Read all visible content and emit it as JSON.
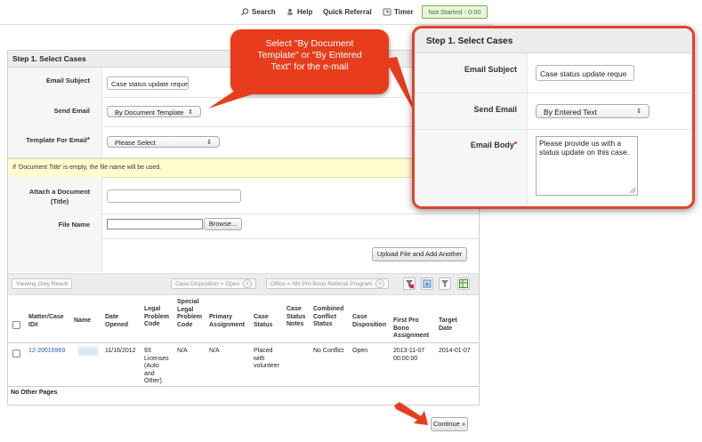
{
  "toolbar": {
    "search": "Search",
    "help": "Help",
    "quick_referral": "Quick Referral",
    "timer": "Timer",
    "status": "Not Started - 0:00"
  },
  "form": {
    "section_title": "Step 1. Select Cases",
    "email_subject_label": "Email Subject",
    "email_subject_value": "Case status update reque",
    "send_email_label": "Send Email",
    "send_email_value": "By Document Template",
    "template_label": "Template For Email",
    "template_value": "Please Select",
    "note": "If 'Document Title' is empty, the file name will be used.",
    "attach_label_1": "Attach a Document",
    "attach_label_2": "(Title)",
    "attach_value": "",
    "file_name_label": "File Name",
    "browse": "Browse...",
    "upload": "Upload File and Add Another"
  },
  "filters": {
    "viewing_only": "Viewing Only Result",
    "chip1": "Case Disposition = Open",
    "chip2": "Office = NH Pro Bono Referral Program",
    "icons": [
      "clear-filter-icon",
      "export-icon",
      "filter-icon",
      "spreadsheet-icon"
    ]
  },
  "table": {
    "headers": {
      "id": [
        "Matter/Case",
        "ID#"
      ],
      "name": [
        "Name"
      ],
      "date_opened": [
        "Date",
        "Opened"
      ],
      "legal_problem": [
        "Legal",
        "Problem",
        "Code"
      ],
      "special_legal": [
        "Special",
        "Legal",
        "Problem",
        "Code"
      ],
      "primary": [
        "Primary",
        "Assignment"
      ],
      "case_status": [
        "Case",
        "Status"
      ],
      "status_notes": [
        "Case",
        "Status",
        "Notes"
      ],
      "conflict": [
        "Combined",
        "Conflict",
        "Status"
      ],
      "disposition": [
        "Case",
        "Disposition"
      ],
      "first_pro_bono": [
        "First Pro",
        "Bono",
        "Assignment"
      ],
      "target": [
        "Target",
        "Date"
      ]
    },
    "row": {
      "id": "12-20016969",
      "date_opened": "11/16/2012",
      "legal_problem": [
        "93",
        "Licenses",
        "(Auto",
        "and",
        "Other)"
      ],
      "special_legal": "N/A",
      "primary": "N/A",
      "case_status": [
        "Placed",
        "with",
        "volunteer"
      ],
      "conflict": "No Conflict",
      "disposition": "Open",
      "first_pro_bono": [
        "2013-11-07",
        "00:00:00"
      ],
      "target": "2014-01-07"
    },
    "footer": "No Other Pages"
  },
  "callout": {
    "line1": "Select \"By Document",
    "line2": "Template\" or \"By Entered",
    "line3": "Text\" for the e-mail"
  },
  "popup": {
    "title": "Step 1. Select Cases",
    "email_subject_label": "Email Subject",
    "email_subject_value": "Case status update reque",
    "send_email_label": "Send Email",
    "send_email_value": "By Entered Text",
    "email_body_label": "Email Body",
    "email_body_value": "Please provide us with a status update on this case."
  },
  "continue": "Continue »",
  "colors": {
    "accent": "#e83d1c",
    "link": "#2a62a8",
    "status_green": "#3a7d16"
  }
}
